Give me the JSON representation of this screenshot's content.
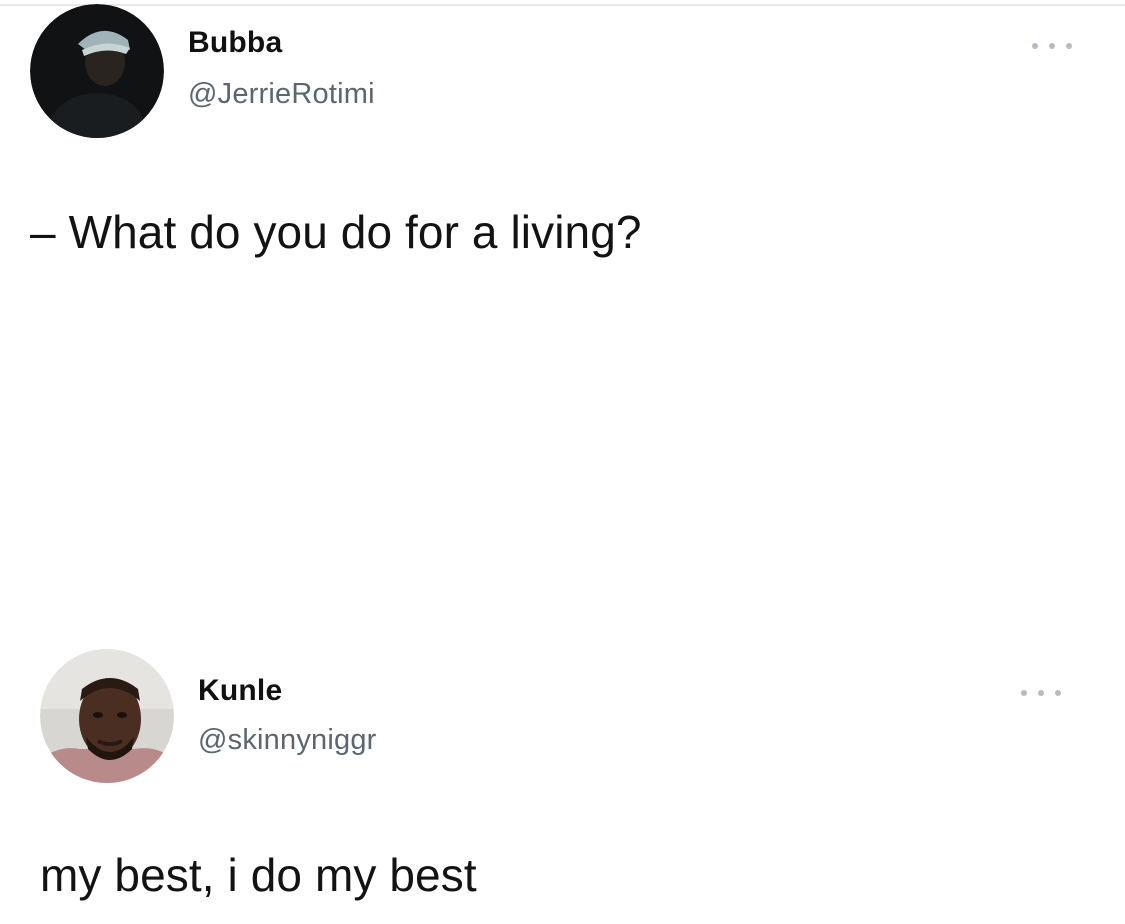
{
  "tweets": [
    {
      "display_name": "Bubba",
      "handle": "@JerrieRotimi",
      "text": "– What do you do for a living?",
      "avatar_icon": "avatar-person-icon",
      "more_icon": "more-options-icon"
    },
    {
      "display_name": "Kunle",
      "handle": "@skinnyniggr",
      "text": "my best, i do my best",
      "avatar_icon": "avatar-person-icon",
      "more_icon": "more-options-icon"
    }
  ],
  "colors": {
    "background": "#ffffff",
    "text": "#131313",
    "handle": "#5b6670",
    "more_dots": "#b7bcc2"
  }
}
